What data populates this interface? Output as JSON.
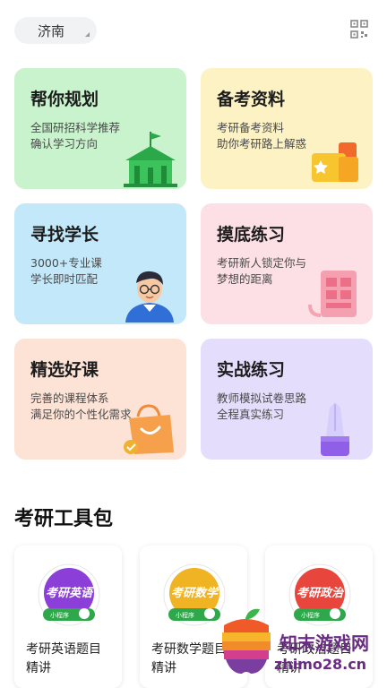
{
  "header": {
    "city": "济南",
    "scan_icon": "qr-scan-icon"
  },
  "cards": [
    {
      "title": "帮你规划",
      "desc": [
        "全国研招科学推荐",
        "确认学习方向"
      ],
      "icon": "school-flag-icon",
      "color": "#c8f3cd"
    },
    {
      "title": "备考资料",
      "desc": [
        "考研备考资料",
        "助你考研路上解惑"
      ],
      "icon": "documents-icon",
      "color": "#fdf2c4"
    },
    {
      "title": "寻找学长",
      "desc": [
        "3000+专业课",
        "学长即时匹配"
      ],
      "icon": "senior-avatar-icon",
      "color": "#c3e8f9"
    },
    {
      "title": "摸底练习",
      "desc": [
        "考研新人锁定你与",
        "梦想的距离"
      ],
      "icon": "exam-paper-icon",
      "color": "#fde0e5"
    },
    {
      "title": "精选好课",
      "desc": [
        "完善的课程体系",
        "满足你的个性化需求"
      ],
      "icon": "shopping-bag-icon",
      "color": "#fde3d6"
    },
    {
      "title": "实战练习",
      "desc": [
        "教师模拟试卷思路",
        "全程真实练习"
      ],
      "icon": "pen-nib-icon",
      "color": "#e4defc"
    }
  ],
  "toolkit": {
    "title": "考研工具包",
    "items": [
      {
        "badge": "考研英语",
        "badge_sub": "小程序",
        "label": [
          "考研英语题目",
          "精讲"
        ],
        "color": "#8b3ed8"
      },
      {
        "badge": "考研数学",
        "badge_sub": "小程序",
        "label": [
          "考研数学题目",
          "精讲"
        ],
        "color": "#f0b323"
      },
      {
        "badge": "考研政治",
        "badge_sub": "小程序",
        "label": [
          "考研政治题目",
          "精讲"
        ],
        "color": "#e8453c"
      }
    ]
  },
  "watermark": {
    "line1": "知末游戏网",
    "line2": "zhimo28.cn"
  }
}
